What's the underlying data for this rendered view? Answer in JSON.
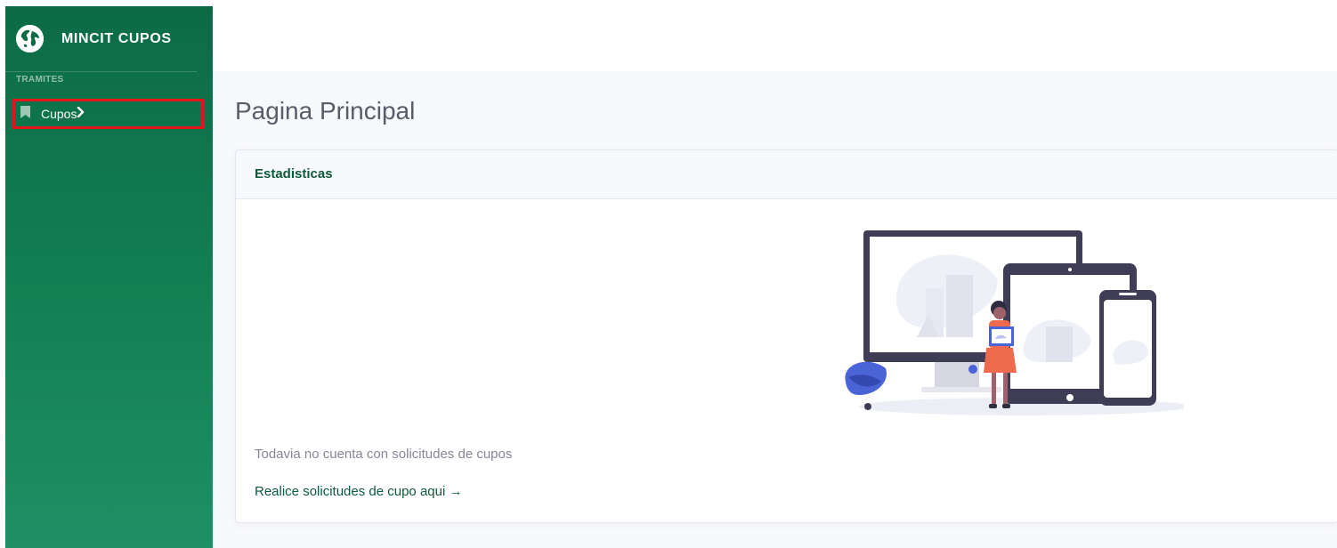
{
  "brand": {
    "title": "MINCIT CUPOS",
    "icon": "globe-icon"
  },
  "sidebar": {
    "section_label": "TRAMITES",
    "items": [
      {
        "label": "Cupos",
        "icon": "bookmark-icon",
        "trailing_icon": "chevron-right-icon"
      }
    ]
  },
  "main": {
    "page_title": "Pagina Principal",
    "card": {
      "header": "Estadisticas",
      "empty_message": "Todavia no cuenta con solicitudes de cupos",
      "cta": "Realice solicitudes de cupo aqui →"
    }
  },
  "colors": {
    "sidebar_top": "#0c6b45",
    "sidebar_bottom": "#1f8f65",
    "accent_text": "#0d5a3a",
    "highlight_border": "#e3141c",
    "muted_text": "#858796"
  }
}
